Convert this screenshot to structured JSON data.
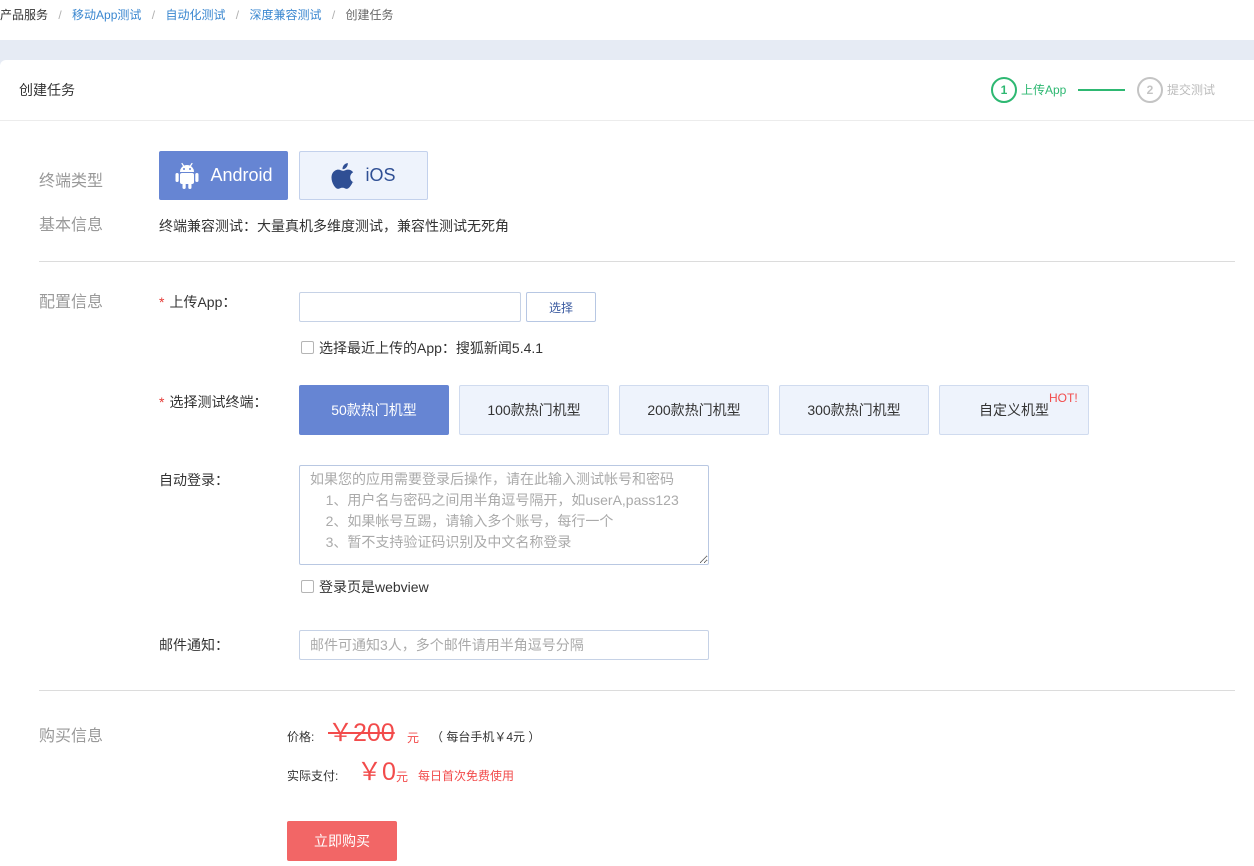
{
  "colors": {
    "link": "#3a87d0",
    "accent": "#6685d3",
    "accent_light_bg": "#eef3fc",
    "step_active": "#2eb872",
    "step_inactive": "#c4c4c4",
    "price_red": "#f24b4b",
    "buy_button": "#f26666",
    "band": "#e6ebf4"
  },
  "breadcrumb": [
    {
      "label": "产品服务"
    },
    {
      "label": "移动App测试"
    },
    {
      "label": "自动化测试"
    },
    {
      "label": "深度兼容测试"
    },
    {
      "label": "创建任务"
    }
  ],
  "breadcrumb_separator": "/",
  "header": {
    "title": "创建任务"
  },
  "steps": [
    {
      "number": "1",
      "label": "上传App",
      "active": true
    },
    {
      "number": "2",
      "label": "提交测试",
      "active": false
    }
  ],
  "terminal_type": {
    "label": "终端类型",
    "options": [
      {
        "label": "Android",
        "icon": "android-icon",
        "selected": true
      },
      {
        "label": "iOS",
        "icon": "apple-icon",
        "selected": false
      }
    ]
  },
  "basic_info": {
    "label": "基本信息",
    "text": "终端兼容测试：大量真机多维度测试，兼容性测试无死角"
  },
  "config": {
    "label": "配置信息",
    "upload_app": {
      "required_mark": "*",
      "label": "上传App：",
      "choose_label": "选择"
    },
    "recent_app": {
      "label": "选择最近上传的App：搜狐新闻5.4.1",
      "checked": false
    },
    "terminals": {
      "required_mark": "*",
      "label": "选择测试终端：",
      "options": [
        {
          "label": "50款热门机型",
          "selected": true
        },
        {
          "label": "100款热门机型",
          "selected": false
        },
        {
          "label": "200款热门机型",
          "selected": false
        },
        {
          "label": "300款热门机型",
          "selected": false
        },
        {
          "label": "自定义机型",
          "selected": false,
          "badge": "HOT!"
        }
      ]
    },
    "auto_login": {
      "label": "自动登录：",
      "placeholder": "如果您的应用需要登录后操作，请在此输入测试帐号和密码\n    1、用户名与密码之间用半角逗号隔开，如userA,pass123\n    2、如果帐号互踢，请输入多个账号，每行一个\n    3、暂不支持验证码识别及中文名称登录"
    },
    "webview": {
      "label": "登录页是webview",
      "checked": false
    },
    "email": {
      "label": "邮件通知：",
      "placeholder": "邮件可通知3人，多个邮件请用半角逗号分隔"
    }
  },
  "purchase": {
    "label": "购买信息",
    "price": {
      "label": "价格:",
      "original": "￥200",
      "unit": "元",
      "note": "（ 每台手机￥4元 ）"
    },
    "actual": {
      "label": "实际支付:",
      "amount": "￥0",
      "unit": "元",
      "note": "每日首次免费使用"
    },
    "buy_label": "立即购买"
  }
}
